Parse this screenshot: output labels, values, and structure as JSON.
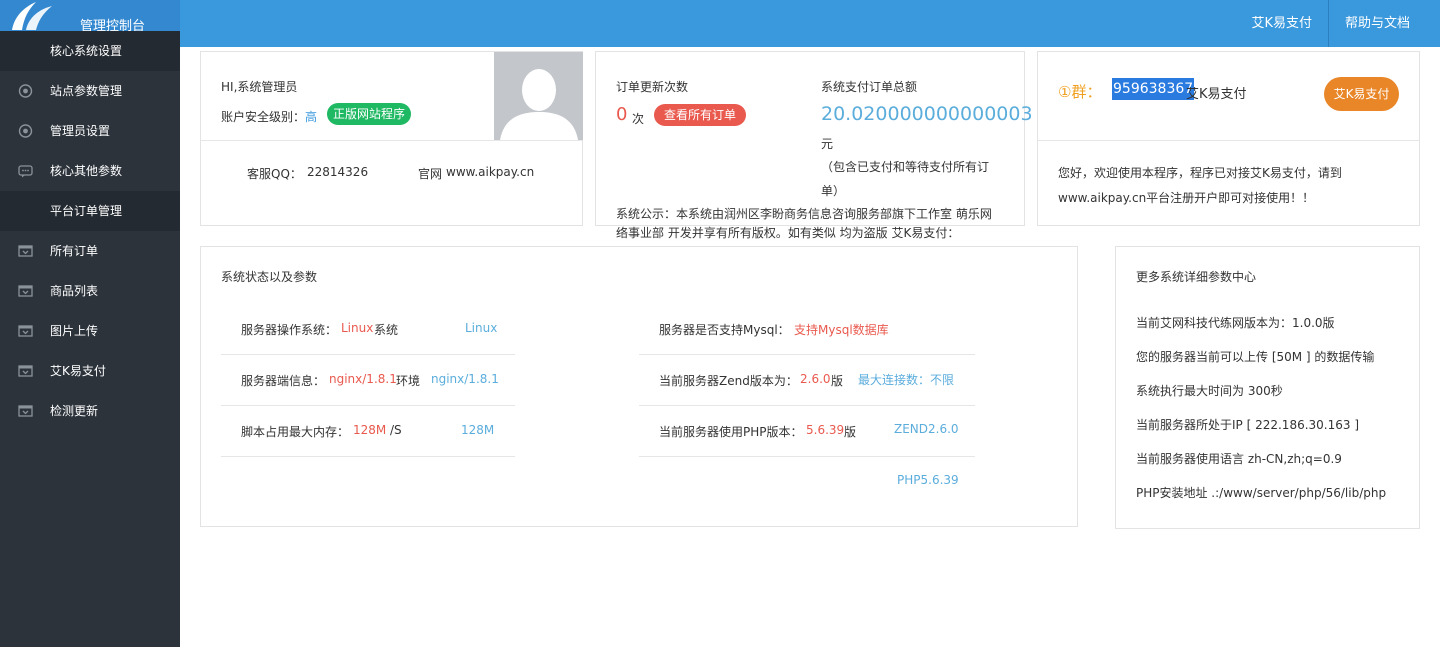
{
  "header": {
    "app_title": "管理控制台",
    "nav": [
      "艾K易支付",
      "帮助与文档"
    ]
  },
  "sidebar": {
    "items": [
      {
        "label": "核心系统设置",
        "icon": "none"
      },
      {
        "label": "站点参数管理",
        "icon": "circle-icon"
      },
      {
        "label": "管理员设置",
        "icon": "circle-icon"
      },
      {
        "label": "核心其他参数",
        "icon": "message-icon"
      },
      {
        "label": "平台订单管理",
        "icon": "none"
      },
      {
        "label": "所有订单",
        "icon": "box-icon"
      },
      {
        "label": "商品列表",
        "icon": "box-icon"
      },
      {
        "label": "图片上传",
        "icon": "box-icon"
      },
      {
        "label": "艾K易支付",
        "icon": "box-icon"
      },
      {
        "label": "检测更新",
        "icon": "box-icon"
      }
    ]
  },
  "admin_card": {
    "greeting": "HI,系统管理员",
    "security_label": "账户安全级别：",
    "security_value": "高",
    "genuine_badge": "正版网站程序",
    "qq_label": "客服QQ：",
    "qq_value": "22814326",
    "site_label": "官网",
    "site_value": "www.aikpay.cn"
  },
  "order_card": {
    "update_label": "订单更新次数",
    "update_count": "0",
    "update_unit": "次",
    "view_all_button": "查看所有订单",
    "total_label": "系统支付订单总额",
    "total_value": "20.020000000000003",
    "total_unit": "元",
    "total_note": "（包含已支付和等待支付所有订单）",
    "notice": "系统公示：本系统由润州区李盼商务信息咨询服务部旗下工作室 萌乐网络事业部 开发并享有所有版权。如有类似 均为盗版 艾K易支付：www.aikpay.cn，欢迎各使用户举报盗版,我们严厉打击盗版程序"
  },
  "group_card": {
    "group_prefix": "①群：",
    "group_number": "959638367",
    "group_suffix": "艾K易支付",
    "button": "艾K易支付",
    "welcome": "您好，欢迎使用本程序，程序已对接艾K易支付，请到www.aikpay.cn平台注册开户即可对接使用！！"
  },
  "status_card": {
    "title": "系统状态以及参数",
    "left_rows": [
      {
        "label": "服务器操作系统：",
        "value": "Linux",
        "suffix": "系统",
        "right": "Linux"
      },
      {
        "label": "服务器端信息：",
        "value": "nginx/1.8.1",
        "suffix": "环境",
        "right": "nginx/1.8.1"
      },
      {
        "label": "脚本占用最大内存：",
        "value": "128M",
        "suffix": "/S",
        "right": "128M"
      }
    ],
    "right_rows": [
      {
        "label": "服务器是否支持Mysql：",
        "value": "支持Mysql数据库",
        "suffix": "",
        "right": ""
      },
      {
        "label": "当前服务器Zend版本为：",
        "value": "2.6.0",
        "suffix": "版",
        "right": "最大连接数：不限"
      },
      {
        "label": "当前服务器使用PHP版本：",
        "value": "5.6.39",
        "suffix": "版",
        "right": "ZEND2.6.0"
      }
    ],
    "php_footer": "PHP5.6.39"
  },
  "params_card": {
    "title": "更多系统详细参数中心",
    "lines": [
      "当前艾网科技代练网版本为：1.0.0版",
      "您的服务器当前可以上传 [50M ] 的数据传输",
      "系统执行最大时间为 300秒",
      "当前服务器所处于IP [ 222.186.30.163 ]",
      "当前服务器使用语言 zh-CN,zh;q=0.9",
      "PHP安装地址 .:/www/server/php/56/lib/php"
    ]
  },
  "colors": {
    "header_blue": "#3a98dd",
    "sidebar_bg": "#2c333b",
    "green": "#1fb863",
    "red": "#e9594e",
    "orange": "#e98628",
    "value_blue": "#5baddc"
  }
}
